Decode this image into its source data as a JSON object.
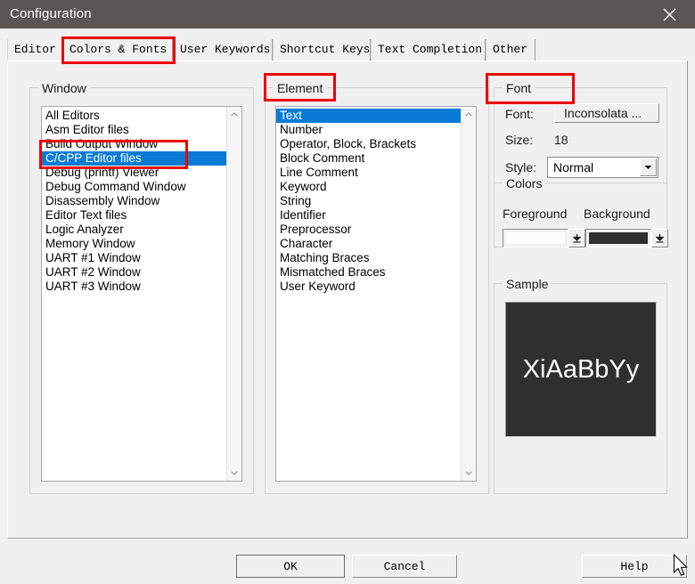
{
  "window": {
    "title": "Configuration",
    "close_icon": "close-icon",
    "titlebar_color": "#5a5654",
    "face_color": "#f0f0f0"
  },
  "tabs": [
    {
      "label": "Editor",
      "selected": false
    },
    {
      "label": "Colors & Fonts",
      "selected": true
    },
    {
      "label": "User Keywords",
      "selected": false
    },
    {
      "label": "Shortcut Keys",
      "selected": false
    },
    {
      "label": "Text Completion",
      "selected": false
    },
    {
      "label": "Other",
      "selected": false
    }
  ],
  "window_group": {
    "title": "Window",
    "items": [
      {
        "label": "All Editors",
        "selected": false
      },
      {
        "label": "Asm Editor files",
        "selected": false
      },
      {
        "label": "Build Output Window",
        "selected": false
      },
      {
        "label": "C/CPP Editor files",
        "selected": true
      },
      {
        "label": "Debug (printf) Viewer",
        "selected": false
      },
      {
        "label": "Debug Command Window",
        "selected": false
      },
      {
        "label": "Disassembly Window",
        "selected": false
      },
      {
        "label": "Editor Text files",
        "selected": false
      },
      {
        "label": "Logic Analyzer",
        "selected": false
      },
      {
        "label": "Memory Window",
        "selected": false
      },
      {
        "label": "UART #1 Window",
        "selected": false
      },
      {
        "label": "UART #2 Window",
        "selected": false
      },
      {
        "label": "UART #3 Window",
        "selected": false
      }
    ]
  },
  "element_group": {
    "title": "Element",
    "items": [
      {
        "label": "Text",
        "selected": true
      },
      {
        "label": "Number",
        "selected": false
      },
      {
        "label": "Operator, Block, Brackets",
        "selected": false
      },
      {
        "label": "Block Comment",
        "selected": false
      },
      {
        "label": "Line Comment",
        "selected": false
      },
      {
        "label": "Keyword",
        "selected": false
      },
      {
        "label": "String",
        "selected": false
      },
      {
        "label": "Identifier",
        "selected": false
      },
      {
        "label": "Preprocessor",
        "selected": false
      },
      {
        "label": "Character",
        "selected": false
      },
      {
        "label": "Matching Braces",
        "selected": false
      },
      {
        "label": "Mismatched Braces",
        "selected": false
      },
      {
        "label": "User Keyword",
        "selected": false
      }
    ]
  },
  "font_group": {
    "title": "Font",
    "font_label": "Font:",
    "font_value": "Inconsolata ...",
    "size_label": "Size:",
    "size_value": "18",
    "style_label": "Style:",
    "style_value": "Normal",
    "style_options": [
      "Normal"
    ],
    "colors": {
      "title": "Colors",
      "foreground_label": "Foreground",
      "background_label": "Background",
      "foreground_value": "#ffffff",
      "background_value": "#2f2f2f"
    }
  },
  "sample_group": {
    "title": "Sample",
    "text": "XiAaBbYy",
    "text_color": "#ffffff",
    "bg_color": "#2f2f2f"
  },
  "buttons": {
    "ok": "OK",
    "cancel": "Cancel",
    "help": "Help"
  },
  "annotations": {
    "color": "#ee0000",
    "boxes": [
      {
        "name": "tab-colors-and-fonts"
      },
      {
        "name": "window-list-selection"
      },
      {
        "name": "element-group-title"
      },
      {
        "name": "font-group-title"
      }
    ]
  },
  "scrollbars": {
    "up_icon": "chevron-up-icon",
    "down_icon": "chevron-down-icon"
  }
}
